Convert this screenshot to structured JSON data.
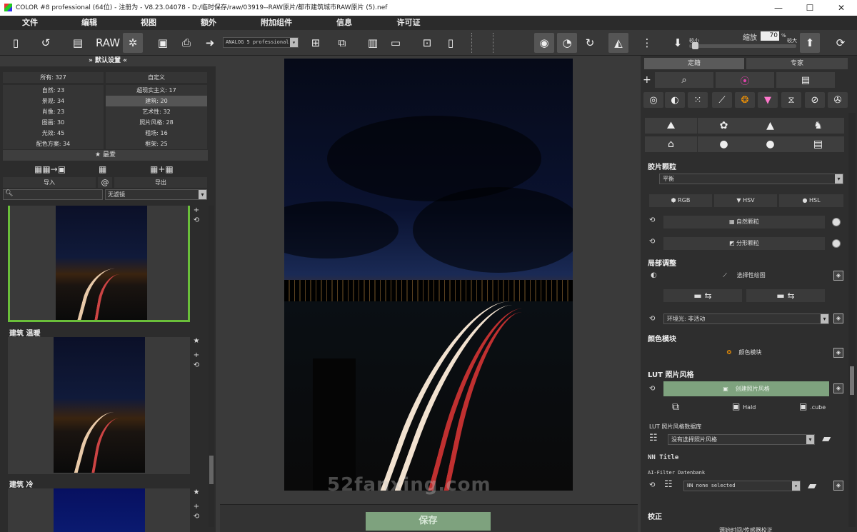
{
  "window": {
    "title": "COLOR #8 professional (64位) - 注册为 - V8.23.04078 - D:/临时保存/raw/03919--RAW原片/都市建筑城市RAW原片 (5).nef",
    "minimize": "—",
    "maximize": "☐",
    "close": "✕"
  },
  "menu": [
    "文件",
    "编辑",
    "视图",
    "额外",
    "附加组件",
    "信息",
    "许可证"
  ],
  "toolbar": {
    "look_select": "ANALOG 5 professional",
    "zoom_label": "缩放",
    "zoom_value": "70",
    "zoom_unit": "%",
    "small": "较小",
    "large": "较大"
  },
  "left": {
    "header": "» 默认设置 «",
    "categories": [
      [
        "所有: 327",
        "自定义"
      ],
      [
        "自然: 23",
        "超现实主义: 17"
      ],
      [
        "景观: 34",
        "建筑: 20"
      ],
      [
        "肖像: 23",
        "艺术性: 32"
      ],
      [
        "图画: 30",
        "照片风格: 28"
      ],
      [
        "光效: 45",
        "粗场: 16"
      ],
      [
        "配色方案: 34",
        "框架: 25"
      ]
    ],
    "favorites": "★ 最爱",
    "import": "导入",
    "at": "@",
    "export": "导出",
    "filter": "无滤镜",
    "thumbs": [
      {
        "label": ""
      },
      {
        "label": "建筑 温暖"
      },
      {
        "label": "建筑 冷"
      }
    ],
    "side_icons": [
      "★",
      "+",
      "⟲"
    ]
  },
  "center": {
    "watermark": "52fanxing.com",
    "save": "保存"
  },
  "right": {
    "tabs": [
      "定籍",
      "专家"
    ],
    "plus": "+",
    "film_grain": "胶片颗粒",
    "grain_preset": "平衡",
    "rgb": "RGB",
    "hsv": "HSV",
    "hsl": "HSL",
    "natural_grain": "自然颗粒",
    "fractal_grain": "分形颗粒",
    "local_adjust": "局部调整",
    "selective_paint": "选择性绘图",
    "vignette": "环境光: 非活动",
    "color_module_title": "颜色模块",
    "color_module": "颜色模块",
    "lut_title": "LUT 照片风格",
    "create_style": "创建照片风格",
    "hald": "Hald",
    "cube": ".cube",
    "lut_db": "LUT 照片风格数据库",
    "no_style": "没有选择照片风格",
    "nn_title": "NN Title",
    "ai_filter": "AI-Filter Datenbank",
    "nn_none": "NN none selected",
    "correct": "校正",
    "bottom_cut": "源始时间/传感器校正"
  }
}
